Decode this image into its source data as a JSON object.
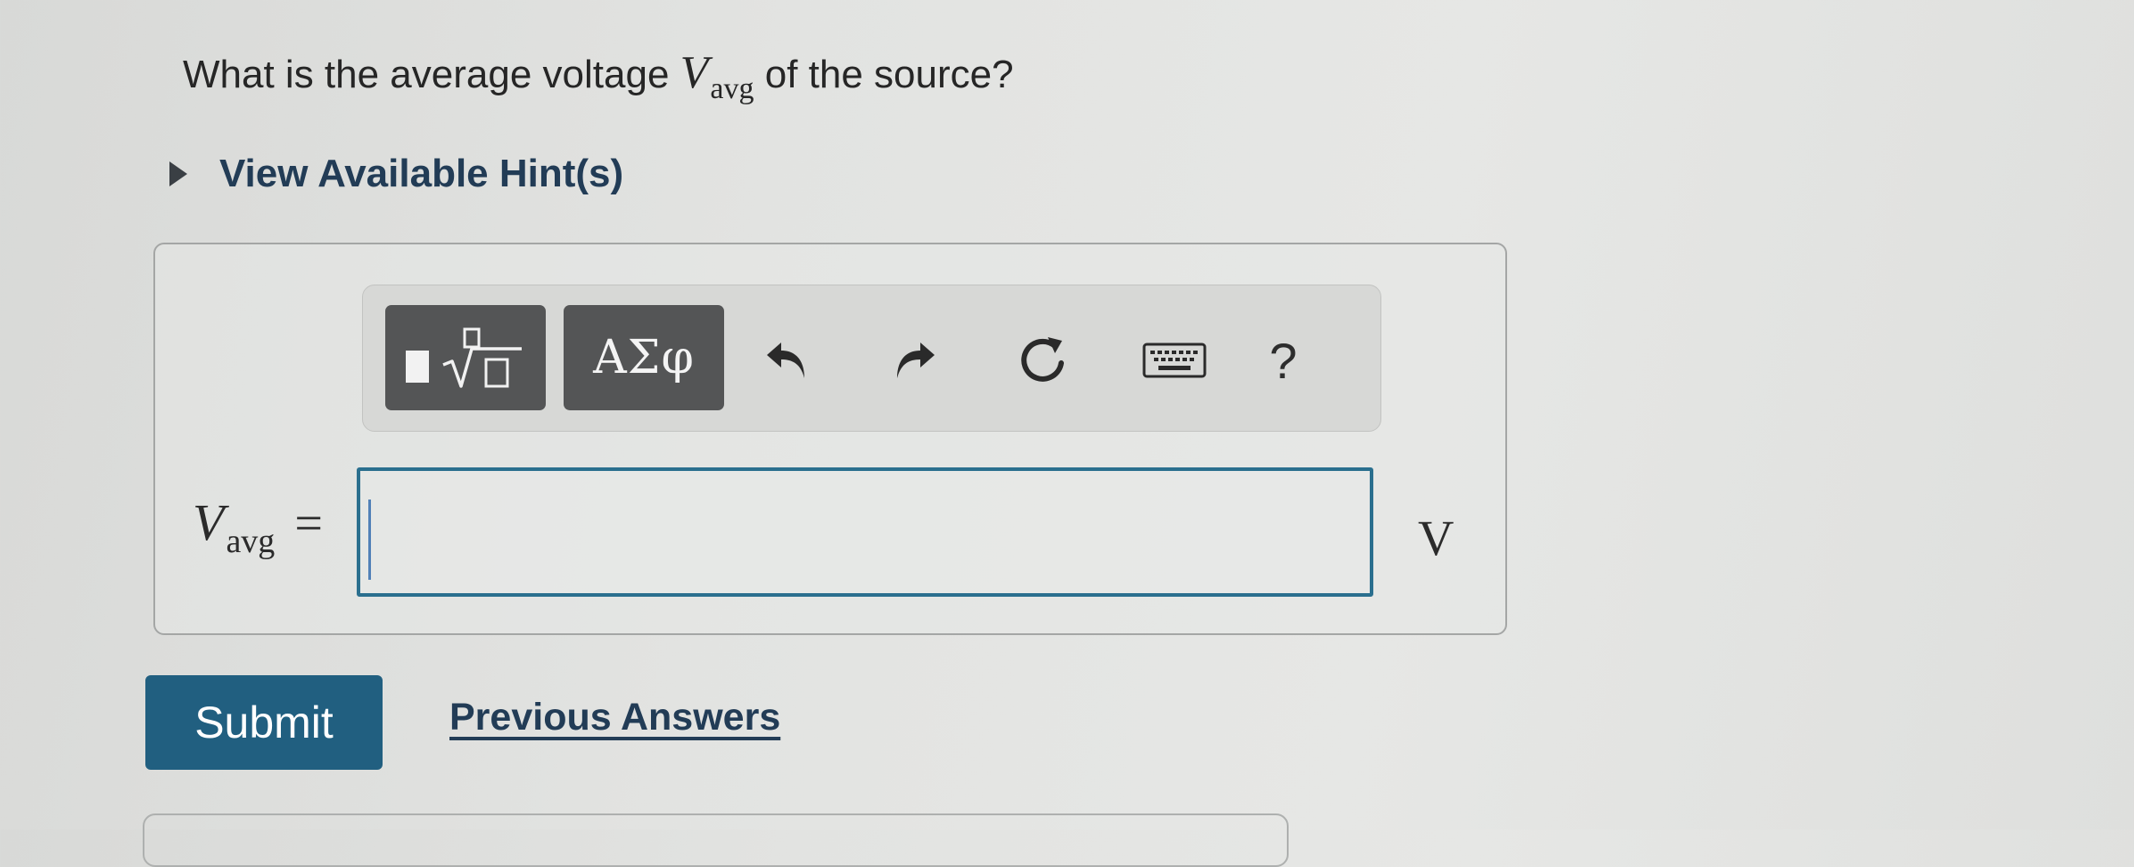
{
  "question": {
    "prefix": "What is the average voltage ",
    "symbol": "V",
    "subscript": "avg",
    "suffix": " of the source?"
  },
  "hints": {
    "label": "View Available Hint(s)"
  },
  "toolbar": {
    "greek_label": "ΑΣφ",
    "help_label": "?",
    "icons": [
      "templates-icon",
      "undo-icon",
      "redo-icon",
      "reset-icon",
      "keyboard-icon",
      "help-icon"
    ]
  },
  "answer": {
    "symbol": "V",
    "subscript": "avg",
    "equals": "=",
    "value": "",
    "unit": "V"
  },
  "actions": {
    "submit_label": "Submit",
    "previous_label": "Previous Answers"
  },
  "colors": {
    "submit_bg": "#215f80",
    "link": "#223c56",
    "input_border": "#2a6f8e",
    "toolbar_button": "#545556"
  }
}
